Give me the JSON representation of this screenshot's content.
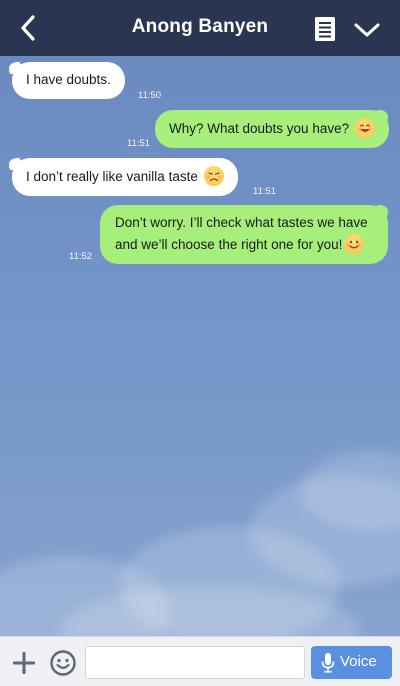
{
  "header": {
    "title": "Anong Banyen",
    "back_icon": "chevron-left-icon",
    "menu_icon": "notes-icon",
    "more_icon": "chevron-down-icon",
    "background": "#2a3651"
  },
  "messages": [
    {
      "direction": "incoming",
      "text": "I have doubts.",
      "time": "11:50"
    },
    {
      "direction": "outgoing",
      "text": "Why? What doubts you have?",
      "emoji": "grinning-face-icon",
      "time": "11:51"
    },
    {
      "direction": "incoming",
      "text": "I don’t really like vanilla taste",
      "emoji": "sad-face-icon",
      "time": "11:51"
    },
    {
      "direction": "outgoing",
      "text_line1": "Don’t worry. I’ll check what tastes we have",
      "text_line2": "and we’ll choose the right one for you!",
      "emoji": "smiling-face-icon",
      "time": "11:52"
    }
  ],
  "composer": {
    "input_value": "",
    "input_placeholder": "",
    "voice_label": "Voice",
    "plus_icon": "plus-icon",
    "emoji_icon": "smiley-icon",
    "mic_icon": "microphone-icon",
    "voice_color": "#5b8fe0"
  },
  "colors": {
    "incoming_bubble": "#ffffff",
    "outgoing_bubble": "#a5ef7a",
    "chat_background": "#7394c8"
  }
}
